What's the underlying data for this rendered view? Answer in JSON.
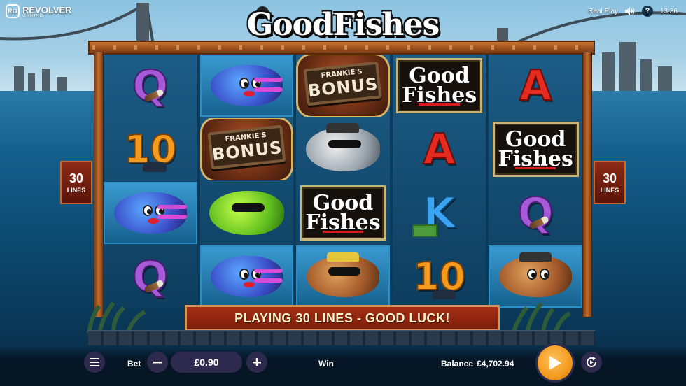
{
  "brand": {
    "name": "REVOLVER",
    "badge": "RG",
    "sub": "GAMING"
  },
  "topbar": {
    "mode": "Real Play",
    "time": "13:36",
    "help": "?"
  },
  "game_title": "GoodFishes",
  "lines_tag": {
    "num": "30",
    "label": "LINES"
  },
  "message": "PLAYING 30 LINES - GOOD LUCK!",
  "symbols_text": {
    "logo_line1": "Good",
    "logo_line2": "Fishes",
    "bonus_small": "FRANKIE'S",
    "bonus_big": "BONUS",
    "q": "Q",
    "a": "A",
    "k": "K",
    "ten": "10"
  },
  "reels": [
    [
      "q-cigar",
      "ten-fedora",
      "fish-blue",
      "q-cigar"
    ],
    [
      "fish-blue",
      "frankies-bonus",
      "fish-green-shades",
      "fish-blue"
    ],
    [
      "frankies-bonus",
      "fish-grey-gun",
      "goodfishes-logo",
      "fish-brown-yellow-hat"
    ],
    [
      "goodfishes-logo",
      "a-rose",
      "k-cash",
      "ten-fedora"
    ],
    [
      "a-rose",
      "goodfishes-logo",
      "q-cigar",
      "fish-brown-boss"
    ]
  ],
  "bottom": {
    "bet_label": "Bet",
    "bet_value": "£0.90",
    "win_label": "Win",
    "balance_label": "Balance",
    "balance_value": "£4,702.94"
  },
  "colors": {
    "accent_orange": "#f39a1f",
    "frame_copper": "#a2521f",
    "banner_red": "#a82e14",
    "button_dark": "#2d2a4d"
  }
}
